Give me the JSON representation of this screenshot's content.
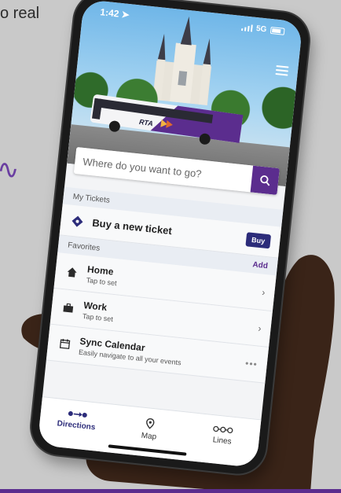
{
  "background": {
    "caption_fragment": "o real",
    "accent_mark": "∿"
  },
  "status_bar": {
    "time": "1:42",
    "network": "5G"
  },
  "search": {
    "placeholder": "Where do you want to go?"
  },
  "bus": {
    "logo_text": "RTA"
  },
  "tickets": {
    "section_label": "My Tickets",
    "buy_label": "Buy a new ticket",
    "buy_button": "Buy"
  },
  "favorites": {
    "section_label": "Favorites",
    "add_label": "Add",
    "items": [
      {
        "title": "Home",
        "subtitle": "Tap to set"
      },
      {
        "title": "Work",
        "subtitle": "Tap to set"
      },
      {
        "title": "Sync Calendar",
        "subtitle": "Easily navigate to all your events"
      }
    ]
  },
  "tabs": [
    {
      "label": "Directions",
      "icon": "directions-icon",
      "active": true
    },
    {
      "label": "Map",
      "icon": "map-pin-icon",
      "active": false
    },
    {
      "label": "Lines",
      "icon": "lines-icon",
      "active": false
    }
  ],
  "colors": {
    "brand_purple": "#5b2d8e",
    "brand_navy": "#2c2c7a"
  }
}
